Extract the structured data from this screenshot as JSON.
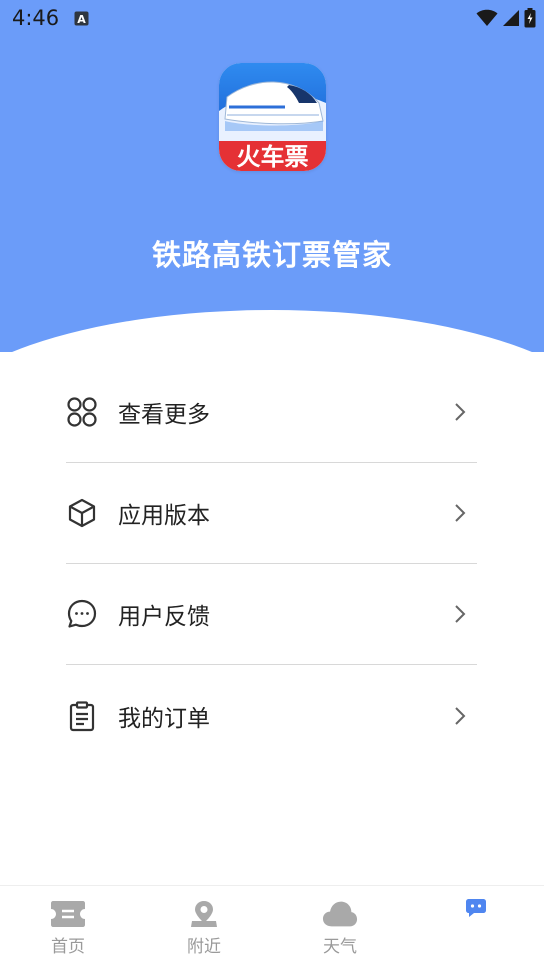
{
  "status_bar": {
    "time": "4:46",
    "notification_icon": "a-letter-icon",
    "icons": [
      "wifi-icon",
      "signal-icon",
      "battery-icon"
    ]
  },
  "header": {
    "logo_text": "火车票",
    "app_title": "铁路高铁订票管家",
    "background_color": "#6b9cf9"
  },
  "menu": {
    "items": [
      {
        "label": "查看更多",
        "icon": "grid-four-icon"
      },
      {
        "label": "应用版本",
        "icon": "cube-icon"
      },
      {
        "label": "用户反馈",
        "icon": "chat-bubble-icon"
      },
      {
        "label": "我的订单",
        "icon": "clipboard-icon"
      }
    ]
  },
  "tabbar": {
    "tabs": [
      {
        "label": "首页",
        "icon": "ticket-icon"
      },
      {
        "label": "附近",
        "icon": "location-pin-icon"
      },
      {
        "label": "天气",
        "icon": "cloud-icon"
      },
      {
        "label": "",
        "icon": "profile-face-icon",
        "active": true
      }
    ],
    "active_color": "#4f86f0"
  }
}
